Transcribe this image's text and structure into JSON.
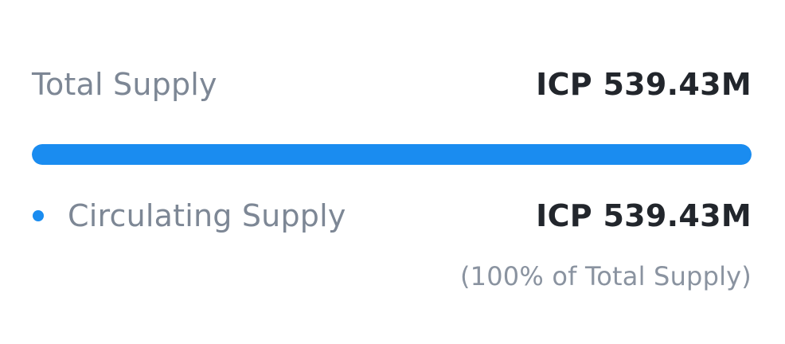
{
  "total_supply": {
    "label": "Total Supply",
    "value": "ICP 539.43M"
  },
  "supply_bar": {
    "fill_fraction": 1.0,
    "fill_color": "#1a8cf0",
    "track_color": "#e6ebf1"
  },
  "circulating_supply": {
    "label": "Circulating Supply",
    "value": "ICP 539.43M",
    "dot_color": "#1a8cf0",
    "share_note": "(100% of Total Supply)"
  }
}
